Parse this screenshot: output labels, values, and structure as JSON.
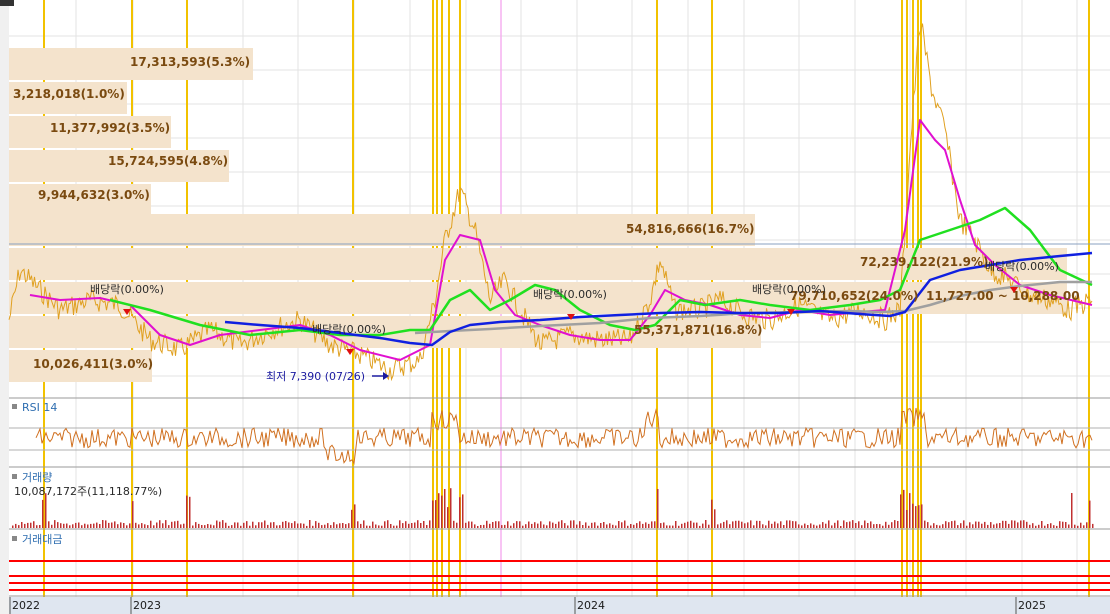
{
  "chart_data": {
    "type": "line",
    "title": "",
    "xlabel": "",
    "ylabel": "",
    "x_ticks": [
      "2022",
      "2023",
      "2024",
      "2025"
    ],
    "volume_profile": [
      {
        "label": "17,313,593(5.3%)"
      },
      {
        "label": "3,218,018(1.0%)"
      },
      {
        "label": "11,377,992(3.5%)"
      },
      {
        "label": "15,724,595(4.8%)"
      },
      {
        "label": "9,944,632(3.0%)"
      },
      {
        "label": "54,816,666(16.7%)"
      },
      {
        "label": "72,239,122(21.9%)"
      },
      {
        "label": "79,710,652(24.0%)"
      },
      {
        "label": "55,371,871(16.8%)"
      },
      {
        "label": "10,026,411(3.0%)"
      }
    ],
    "dividend_labels": [
      "배당락(0.00%)",
      "배당락(0.00%)",
      "배당락(0.00%)",
      "배당락(0.00%)",
      "배당락(0.00%)"
    ],
    "range_label": "11,727.00 ~ 10,288.00",
    "low_marker": "최저 7,390 (07/26)",
    "panes": {
      "rsi": {
        "title": "RSI 14"
      },
      "volume": {
        "title": "거래량",
        "value": "10,087,172주(11,118.77%)"
      },
      "amount": {
        "title": "거래대금"
      }
    },
    "colors": {
      "price": "#e0a020",
      "ma_short": "#e010d0",
      "ma_mid": "#20e020",
      "ma_long": "#1020e0",
      "ma_longest": "#a0a0a0",
      "event_line": "#f2c200",
      "rsi": "#d07020",
      "volume": "#c03030",
      "profile_bar": "#f4e3cc"
    }
  }
}
